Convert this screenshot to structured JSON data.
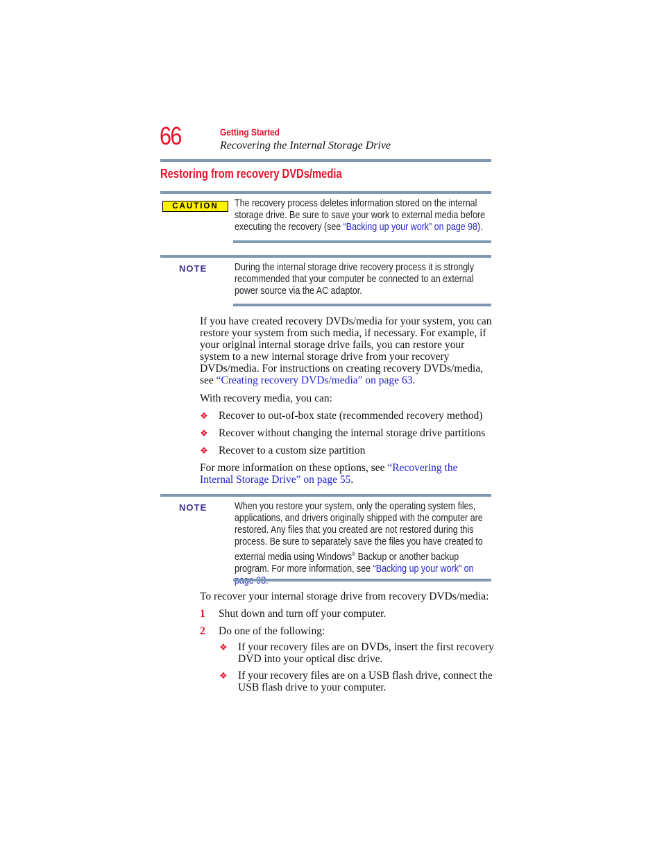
{
  "header": {
    "page_number": "66",
    "chapter": "Getting Started",
    "section": "Recovering the Internal Storage Drive"
  },
  "heading": "Restoring from recovery DVDs/media",
  "caution": {
    "label": "CAUTION",
    "text_1": "The recovery process deletes information stored on the internal storage drive. Be sure to save your work to external media before executing the recovery (see ",
    "link": "“Backing up your work” on page 98",
    "text_2": ")."
  },
  "note_1": {
    "label": "NOTE",
    "text": "During the internal storage drive recovery process it is strongly recommended that your computer be connected to an external power source via the AC adaptor."
  },
  "intro": {
    "text": "If you have created recovery DVDs/media for your system, you can restore your system from such media, if necessary. For example, if your original internal storage drive fails, you can restore your system to a new internal storage drive from your recovery DVDs/media. For instructions on creating recovery DVDs/media, see ",
    "link": "“Creating recovery DVDs/media” on page 63",
    "end": "."
  },
  "options_intro": "With recovery media, you can:",
  "bullet_symbol": "❖",
  "options": [
    "Recover to out-of-box state (recommended recovery method)",
    "Recover without changing the internal storage drive partitions",
    "Recover to a custom size partition"
  ],
  "more_info": {
    "text": "For more information on these options, see ",
    "link": "“Recovering the Internal Storage Drive” on page 55",
    "end": "."
  },
  "note_2": {
    "label": "NOTE",
    "text_1": "When you restore your system, only the operating system files, applications, and drivers originally shipped with the computer are restored. Any files that you created are not restored during this process. Be sure to separately save the files you have created to external media using Windows",
    "sup": "®",
    "text_2": " Backup or another backup program. For more information, see ",
    "link": "“Backing up your work” on page 98",
    "end": "."
  },
  "steps_intro": "To recover your internal storage drive from recovery DVDs/media:",
  "steps": [
    {
      "num": "1",
      "text": "Shut down and turn off your computer."
    },
    {
      "num": "2",
      "text": "Do one of the following:"
    }
  ],
  "sub_options": [
    "If your recovery files are on DVDs, insert the first recovery DVD into your optical disc drive.",
    "If your recovery files are on a USB flash drive, connect the USB flash drive to your computer."
  ]
}
